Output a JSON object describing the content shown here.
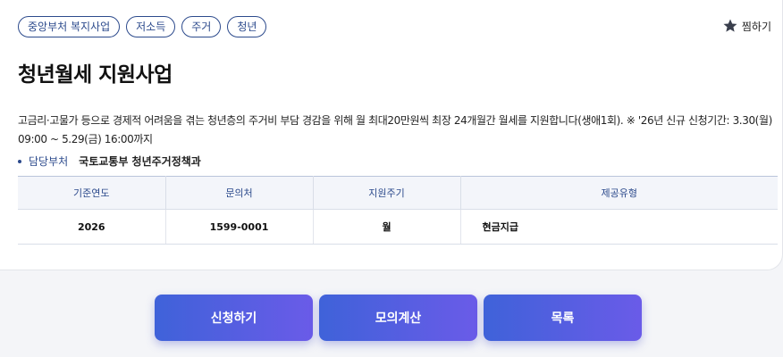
{
  "tags": [
    "중앙부처 복지사업",
    "저소득",
    "주거",
    "청년"
  ],
  "bookmark": {
    "label": "찜하기",
    "icon": "star-icon"
  },
  "title": "청년월세 지원사업",
  "description": "고금리·고물가 등으로 경제적 어려움을 겪는 청년층의 주거비 부담 경감을 위해 월 최대20만원씩 최장 24개월간 월세를 지원합니다(생애1회). ※ '26년 신규 신청기간: 3.30(월) 09:00 ~ 5.29(금) 16:00까지",
  "department": {
    "label": "담당부처",
    "value": "국토교통부 청년주거정책과"
  },
  "table": {
    "headers": [
      "기준연도",
      "문의처",
      "지원주기",
      "제공유형"
    ],
    "row": [
      "2026",
      "1599-0001",
      "월",
      "현금지급"
    ]
  },
  "buttons": {
    "apply": "신청하기",
    "simulate": "모의계산",
    "list": "목록"
  },
  "colors": {
    "accent": "#2c4a8c",
    "button_start": "#3f62d9",
    "button_end": "#6a5be8"
  }
}
